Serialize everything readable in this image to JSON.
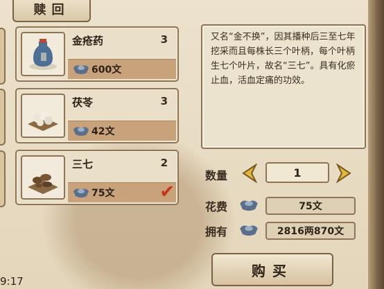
{
  "tab": {
    "label": "赎回"
  },
  "items": [
    {
      "name": "金疮药",
      "qty": "3",
      "price": "600文",
      "icon": "medicine-bottle-icon"
    },
    {
      "name": "茯苓",
      "qty": "3",
      "price": "42文",
      "icon": "herb-pile-icon"
    },
    {
      "name": "三七",
      "qty": "2",
      "price": "75文",
      "icon": "root-pile-icon",
      "selected": true
    }
  ],
  "description": "又名“金不换”，因其播种后三至七年挖采而且每株长三个叶柄，每个叶柄生七个叶片，故名“三七”。具有化瘀止血，活血定痛的功效。",
  "quantity": {
    "label": "数量",
    "value": "1"
  },
  "cost": {
    "label": "花费",
    "value": "75文"
  },
  "owned": {
    "label": "拥有",
    "value": "2816两870文"
  },
  "buy_label": "购买",
  "clock": "9:17",
  "colors": {
    "price_strip": "#c7a27b",
    "check": "#c8341b",
    "ingot": "#5b6f8a"
  }
}
